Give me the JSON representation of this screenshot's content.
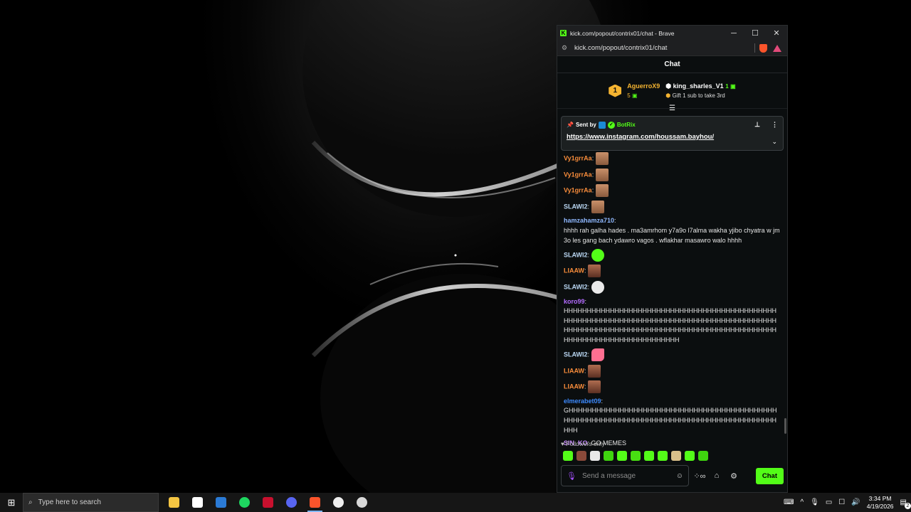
{
  "browser": {
    "title": "kick.com/popout/contrix01/chat - Brave",
    "url": "kick.com/popout/contrix01/chat",
    "minimize": "─",
    "maximize": "☐",
    "close": "✕"
  },
  "chat": {
    "header": "Chat",
    "leaderboard": {
      "rank1_badge": "1",
      "rank1_name": "AguerroX9",
      "rank1_subs": "5",
      "rank2_name": "king_sharles_V1",
      "rank2_subs": "1",
      "gift_text": "Gift 1 sub to take 3rd"
    },
    "pinned": {
      "sent_by": "Sent by",
      "bot_name": "BotRix",
      "link": "https://www.instagram.com/houssam.bayhou/"
    },
    "messages": [
      {
        "user": "Vy1grrAa",
        "color": "#f78c3b",
        "text": "",
        "emote": "em-face"
      },
      {
        "user": "Vy1grrAa",
        "color": "#f78c3b",
        "text": "",
        "emote": "em-face"
      },
      {
        "user": "Vy1grrAa",
        "color": "#f78c3b",
        "text": "",
        "emote": "em-face"
      },
      {
        "user": "SLAWI2",
        "color": "#b9d6f2",
        "text": "",
        "emote": "em-face"
      },
      {
        "user": "hamzahamza710",
        "color": "#8fb8ff",
        "text": "hhhh rah galha hades . ma3amrhom y7a9o l7alma wakha yjibo chyatra w jm3o les gang bach ydawro vagos . wflakhar masawro walo hhhh",
        "emote": ""
      },
      {
        "user": "SLAWI2",
        "color": "#b9d6f2",
        "text": "",
        "emote": "em-green"
      },
      {
        "user": "LIAAW",
        "color": "#f78c3b",
        "text": "",
        "emote": "em-dark"
      },
      {
        "user": "SLAWI2",
        "color": "#b9d6f2",
        "text": "",
        "emote": "em-white"
      },
      {
        "user": "koro99",
        "color": "#b36bff",
        "text": "HHHHHHHHHHHHHHHHHHHHHHHHHHHHHHHHHHHHHHHHHHHHHHHHHHHHHHHHHHHHHHHHHHHHHHHHHHHHHHHHHHHHHHHHHHHHHHHHHHHHHHHHHHHHHHHHHHHHHHHHHHHHHHHHHHHHHHHHHHHHHHHHHHHHHHHHHHHHHHHHHHH",
        "emote": ""
      },
      {
        "user": "SLAWI2",
        "color": "#b9d6f2",
        "text": "",
        "emote": "em-pink"
      },
      {
        "user": "LIAAW",
        "color": "#f78c3b",
        "text": "",
        "emote": "em-dark"
      },
      {
        "user": "LIAAW",
        "color": "#f78c3b",
        "text": "",
        "emote": "em-dark"
      },
      {
        "user": "elmerabet09",
        "color": "#3d8bff",
        "text": "GHHHHHHHHHHHHHHHHHHHHHHHHHHHHHHHHHHHHHHHHHHHHHHHHHHHHHHHHHHHHHHHHHHHHHHHHHHHHHHHHHHHHHHHHHHHHHH",
        "emote": ""
      },
      {
        "user": "SIN_KO",
        "color": "#c88cff",
        "text": "GO MEMES",
        "emote": ""
      }
    ],
    "followers_only": "Followers only",
    "input_placeholder": "Send a message",
    "send_button": "Chat"
  },
  "taskbar": {
    "search_placeholder": "Type here to search",
    "time": "3:34 PM",
    "date": "4/19/2026",
    "notification_count": "2"
  },
  "colors": {
    "kick_green": "#53fc18",
    "chat_bg": "#0b0e0f"
  }
}
